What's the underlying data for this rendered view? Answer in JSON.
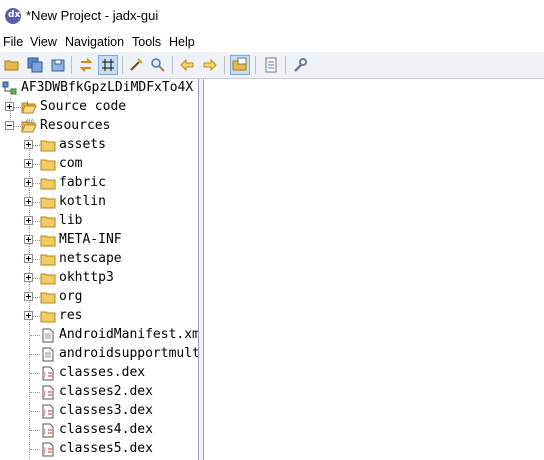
{
  "window": {
    "title": "*New Project - jadx-gui"
  },
  "menu": [
    "File",
    "View",
    "Navigation",
    "Tools",
    "Help"
  ],
  "toolbar": {
    "buttons": [
      "open-file-icon",
      "save-all-icon",
      "export-icon",
      "sync-icon",
      "flatten-packages-icon",
      "deobfuscation-icon",
      "search-icon",
      "back-icon",
      "forward-icon",
      "quick-tabs-icon",
      "log-icon",
      "preferences-icon"
    ],
    "pressed": [
      "flatten-packages-icon",
      "quick-tabs-icon"
    ]
  },
  "tree": {
    "root": "AF3DWBfkGpzLDiMDFxTo4X",
    "nodes": [
      {
        "label": "Source code",
        "type": "source",
        "expanded": false
      },
      {
        "label": "Resources",
        "type": "resources",
        "expanded": true,
        "children": [
          {
            "label": "assets",
            "type": "folder"
          },
          {
            "label": "com",
            "type": "folder"
          },
          {
            "label": "fabric",
            "type": "folder"
          },
          {
            "label": "kotlin",
            "type": "folder"
          },
          {
            "label": "lib",
            "type": "folder"
          },
          {
            "label": "META-INF",
            "type": "folder"
          },
          {
            "label": "netscape",
            "type": "folder"
          },
          {
            "label": "okhttp3",
            "type": "folder"
          },
          {
            "label": "org",
            "type": "folder"
          },
          {
            "label": "res",
            "type": "folder"
          },
          {
            "label": "AndroidManifest.xml",
            "type": "file"
          },
          {
            "label": "androidsupportmultidexversion.txt",
            "type": "file"
          },
          {
            "label": "classes.dex",
            "type": "dex"
          },
          {
            "label": "classes2.dex",
            "type": "dex"
          },
          {
            "label": "classes3.dex",
            "type": "dex"
          },
          {
            "label": "classes4.dex",
            "type": "dex"
          },
          {
            "label": "classes5.dex",
            "type": "dex"
          }
        ]
      }
    ]
  }
}
